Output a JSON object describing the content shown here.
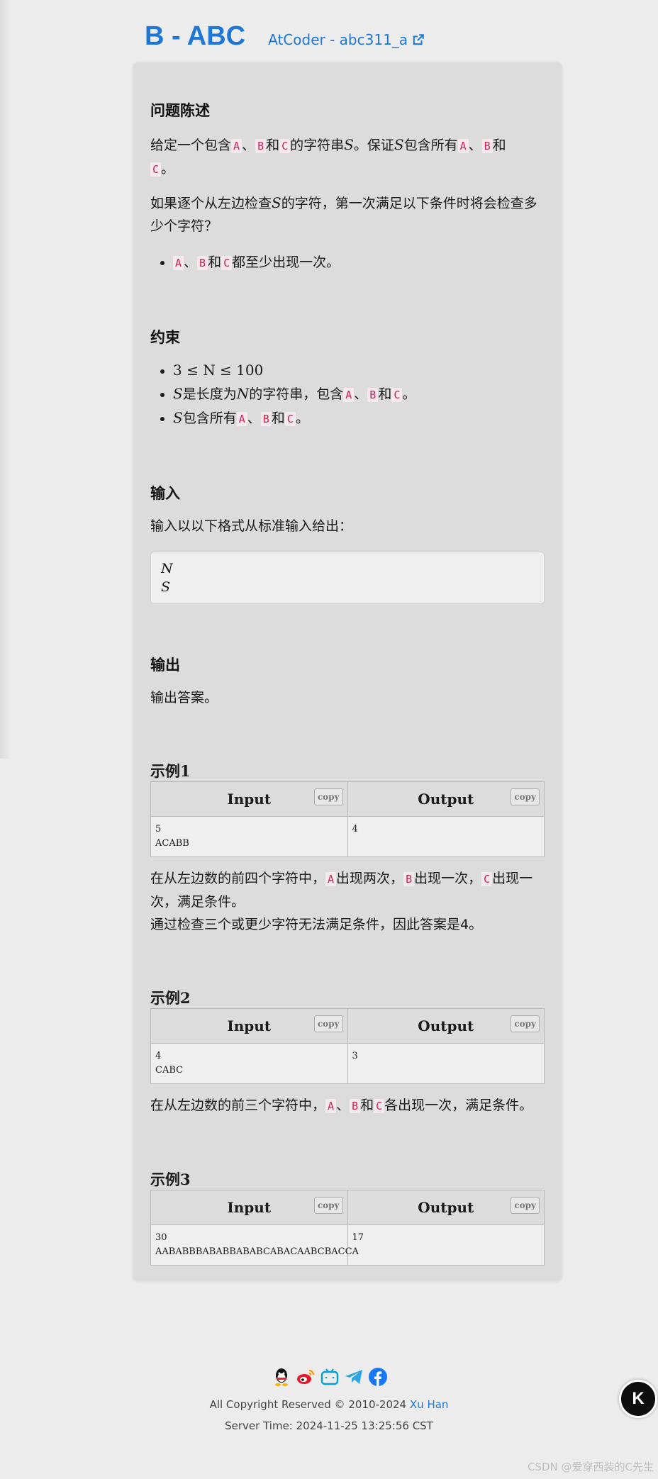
{
  "header": {
    "title": "B - ABC",
    "source_link": "AtCoder - abc311_a"
  },
  "tok": {
    "A": "A",
    "B": "B",
    "C": "C"
  },
  "math": {
    "S": "S",
    "N": "N"
  },
  "statement": {
    "heading": "问题陈述",
    "p1_a": "给定一个包含",
    "sep": "、",
    "and": "和",
    "p1_b": "的字符串",
    "p1_c": "。保证",
    "p1_d": "包含所有",
    "period": "。",
    "p2_a": "如果逐个从左边检查",
    "p2_b": "的字符，第一次满足以下条件时将会检查多少个字符？",
    "bullet_tail": "都至少出现一次。"
  },
  "constraints": {
    "heading": "约束",
    "item1": "3 ≤ N ≤ 100",
    "item2_a": "是长度为",
    "item2_b": "的字符串，包含",
    "item3_a": "包含所有"
  },
  "input_section": {
    "heading": "输入",
    "desc": "输入以以下格式从标准输入给出：",
    "format_line1": "N",
    "format_line2": "S"
  },
  "output_section": {
    "heading": "输出",
    "desc": "输出答案。"
  },
  "io": {
    "input_header": "Input",
    "output_header": "Output",
    "copy_label": "copy"
  },
  "samples": [
    {
      "title": "示例1",
      "input_line1": "5",
      "input_line2": "ACABB",
      "output": "4",
      "exp_a": "在从左边数的前四个字符中，",
      "exp_b": "出现两次，",
      "exp_c": "出现一次，",
      "exp_d": "出现一次，满足条件。",
      "exp_line2": "通过检查三个或更少字符无法满足条件，因此答案是4。"
    },
    {
      "title": "示例2",
      "input_line1": "4",
      "input_line2": "CABC",
      "output": "3",
      "exp_a": "在从左边数的前三个字符中，",
      "exp_b": "各出现一次，满足条件。"
    },
    {
      "title": "示例3",
      "input_line1": "30",
      "input_line2": "AABABBBABABBABABCABACAABCBACCA",
      "output": "17"
    }
  ],
  "footer": {
    "social_icons": [
      "qq-icon",
      "weibo-icon",
      "bilibili-icon",
      "telegram-icon",
      "facebook-icon"
    ],
    "copyright_prefix": "All Copyright Reserved © 2010-2024",
    "author": "Xu Han",
    "server_time": "Server Time: 2024-11-25 13:25:56 CST"
  },
  "fab_label": "K",
  "watermark": "CSDN @爱穿西装的C先生",
  "colors": {
    "link": "#1e77d6",
    "code": "#c7254e",
    "card": "#dcdcdc",
    "page": "#ececec"
  }
}
